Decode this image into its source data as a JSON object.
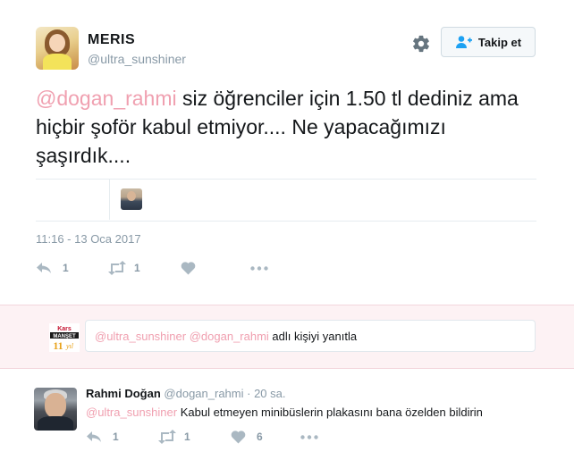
{
  "tweet": {
    "author_name": "MERIS",
    "author_handle": "@ultra_sunshiner",
    "follow_label": "Takip et",
    "mention": "@dogan_rahmi",
    "text_body": " siz öğrenciler için 1.50 tl dediniz ama hiçbir şoför kabul etmiyor.... Ne yapacağımızı şaşırdık....",
    "timestamp": "11:16 - 13 Oca 2017",
    "actions": {
      "reply_count": "1",
      "retweet_count": "1"
    }
  },
  "reply_box": {
    "mention_1": "@ultra_sunshiner",
    "mention_2": "@dogan_rahmi",
    "suffix": " adlı kişiyi yanıtla",
    "logo_text_top": "Kars",
    "logo_text_mid": "MANŞET",
    "logo_text_bottom": "yıl"
  },
  "reply": {
    "author_name": "Rahmi Doğan",
    "author_handle": "@dogan_rahmi",
    "time": "· 20 sa.",
    "mention": "@ultra_sunshiner",
    "text_body": " Kabul etmeyen minibüslerin plakasını bana özelden bildirin",
    "actions": {
      "reply_count": "1",
      "retweet_count": "1",
      "like_count": "6"
    }
  },
  "colors": {
    "mention": "#f0a0b0",
    "muted": "#8899a6",
    "reply_bg": "#fdf2f4"
  }
}
